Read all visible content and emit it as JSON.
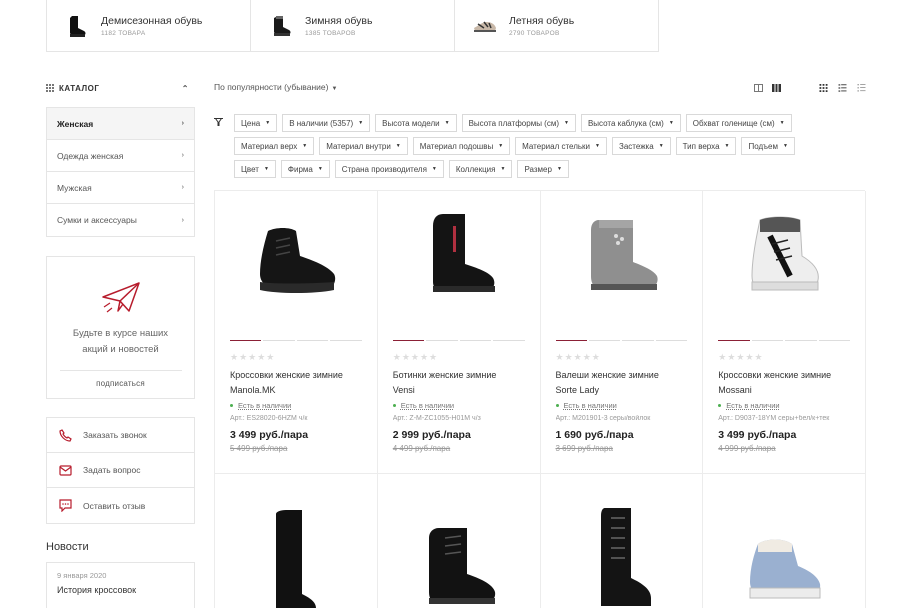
{
  "categories": [
    {
      "title": "Демисезонная обувь",
      "count": "1182 ТОВАРА",
      "icon": "demi-boot-icon"
    },
    {
      "title": "Зимняя обувь",
      "count": "1385 ТОВАРОВ",
      "icon": "winter-boot-icon"
    },
    {
      "title": "Летняя обувь",
      "count": "2790 ТОВАРОВ",
      "icon": "sandal-icon"
    }
  ],
  "sidebar": {
    "catalog_label": "КАТАЛОГ",
    "items": [
      {
        "label": "Женская"
      },
      {
        "label": "Одежда женская"
      },
      {
        "label": "Мужская"
      },
      {
        "label": "Сумки и аксессуары"
      }
    ],
    "subscribe": {
      "text_line1": "Будьте в курсе наших",
      "text_line2": "акций и новостей",
      "link": "подписаться"
    },
    "actions": [
      {
        "label": "Заказать звонок"
      },
      {
        "label": "Задать вопрос"
      },
      {
        "label": "Оставить отзыв"
      }
    ],
    "news_title": "Новости",
    "news": {
      "date": "9 января 2020",
      "title": "История кроссовок"
    }
  },
  "sort_label": "По популярности (убывание)",
  "filters": [
    [
      "Цена",
      "В наличии (5357)",
      "Высота модели",
      "Высота платформы (см)",
      "Высота каблука (см)",
      "Обхват голенище (см)"
    ],
    [
      "Материал верх",
      "Материал внутри",
      "Материал подошвы",
      "Материал стельки",
      "Застежка",
      "Тип верха",
      "Подъем"
    ],
    [
      "Цвет",
      "Фирма",
      "Страна производителя",
      "Коллекция",
      "Размер"
    ]
  ],
  "products": [
    {
      "name_line1": "Кроссовки женские зимние",
      "name_line2": "Manola.MK",
      "stock": "Есть в наличии",
      "art": "Арт.: ES28020-6HZM ч/к",
      "price": "3 499 руб./пара",
      "old": "5 499 руб./пара"
    },
    {
      "name_line1": "Ботинки женские зимние",
      "name_line2": "Vensi",
      "stock": "Есть в наличии",
      "art": "Арт.: Z-M-ZC1055-H01M ч/з",
      "price": "2 999 руб./пара",
      "old": "4 499 руб./пара"
    },
    {
      "name_line1": "Валеши женские зимние",
      "name_line2": "Sorte Lady",
      "stock": "Есть в наличии",
      "art": "Арт.: M201901-3 серы/войлок",
      "price": "1 690 руб./пара",
      "old": "3 699 руб./пара"
    },
    {
      "name_line1": "Кроссовки женские зимние",
      "name_line2": "Mossani",
      "stock": "Есть в наличии",
      "art": "Арт.: D9037-18YM серы+бел/к+тек",
      "price": "3 499 руб./пара",
      "old": "4 999 руб./пара"
    }
  ],
  "rating_stars": "★★★★★"
}
